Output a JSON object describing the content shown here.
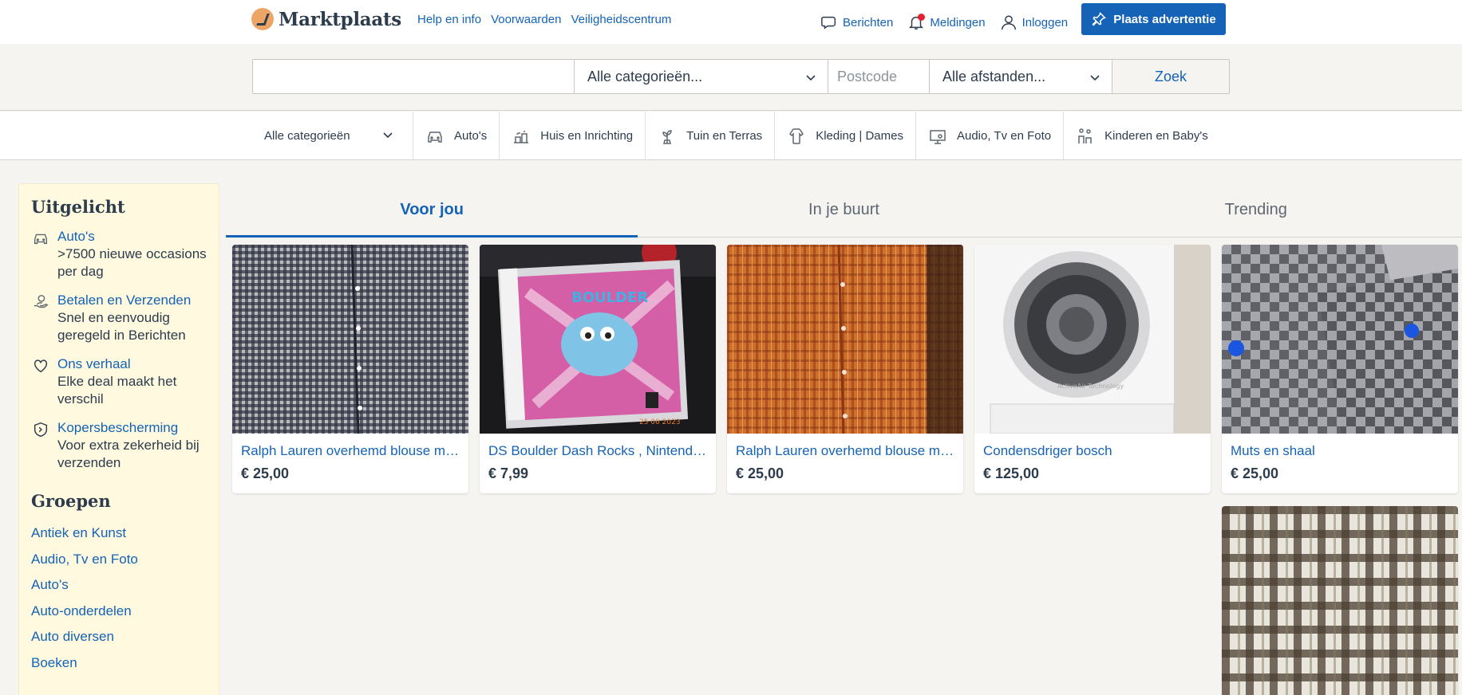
{
  "header": {
    "brand": "Marktplaats",
    "links": [
      "Help en info",
      "Voorwaarden",
      "Veiligheidscentrum"
    ],
    "messages": "Berichten",
    "notifications": "Meldingen",
    "login": "Inloggen",
    "post_ad": "Plaats advertentie",
    "notification_dot_color": "#e3202d"
  },
  "search": {
    "query_placeholder": "",
    "category": "Alle categorieën...",
    "postcode_placeholder": "Postcode",
    "distance": "Alle afstanden...",
    "button": "Zoek"
  },
  "categories": {
    "all": "Alle categorieën",
    "items": [
      {
        "label": "Auto's",
        "icon": "car-icon"
      },
      {
        "label": "Huis en Inrichting",
        "icon": "home-icon"
      },
      {
        "label": "Tuin en Terras",
        "icon": "plant-icon"
      },
      {
        "label": "Kleding | Dames",
        "icon": "clothing-icon"
      },
      {
        "label": "Audio, Tv en Foto",
        "icon": "tv-icon"
      },
      {
        "label": "Kinderen en Baby's",
        "icon": "kids-icon"
      }
    ]
  },
  "sidebar": {
    "featured_title": "Uitgelicht",
    "featured": [
      {
        "link": "Auto's",
        "desc": ">7500 nieuwe occasions per dag",
        "icon": "car-icon"
      },
      {
        "link": "Betalen en Verzenden",
        "desc": "Snel en eenvoudig geregeld in Berichten",
        "icon": "payment-hand-icon"
      },
      {
        "link": "Ons verhaal",
        "desc": "Elke deal maakt het verschil",
        "icon": "heart-icon"
      },
      {
        "link": "Kopersbescherming",
        "desc": "Voor extra zekerheid bij verzenden",
        "icon": "shield-icon"
      }
    ],
    "groups_title": "Groepen",
    "groups": [
      "Antiek en Kunst",
      "Audio, Tv en Foto",
      "Auto's",
      "Auto-onderdelen",
      "Auto diversen",
      "Boeken"
    ]
  },
  "tabs": [
    {
      "label": "Voor jou",
      "active": true
    },
    {
      "label": "In je buurt",
      "active": false
    },
    {
      "label": "Trending",
      "active": false
    }
  ],
  "listings": [
    {
      "title": "Ralph Lauren overhemd blouse maat L",
      "price": "€ 25,00"
    },
    {
      "title": "DS Boulder Dash Rocks , Nintendo DS",
      "price": "€ 7,99"
    },
    {
      "title": "Ralph Lauren overhemd blouse maat L",
      "price": "€ 25,00"
    },
    {
      "title": "Condensdriger bosch",
      "price": "€ 125,00"
    },
    {
      "title": "Muts en shaal",
      "price": "€ 25,00"
    }
  ],
  "colors": {
    "brand_blue": "#1463b6",
    "sidebar_bg": "#fef9df",
    "page_bg": "#f5f4f1",
    "logo_orange": "#eda566"
  }
}
